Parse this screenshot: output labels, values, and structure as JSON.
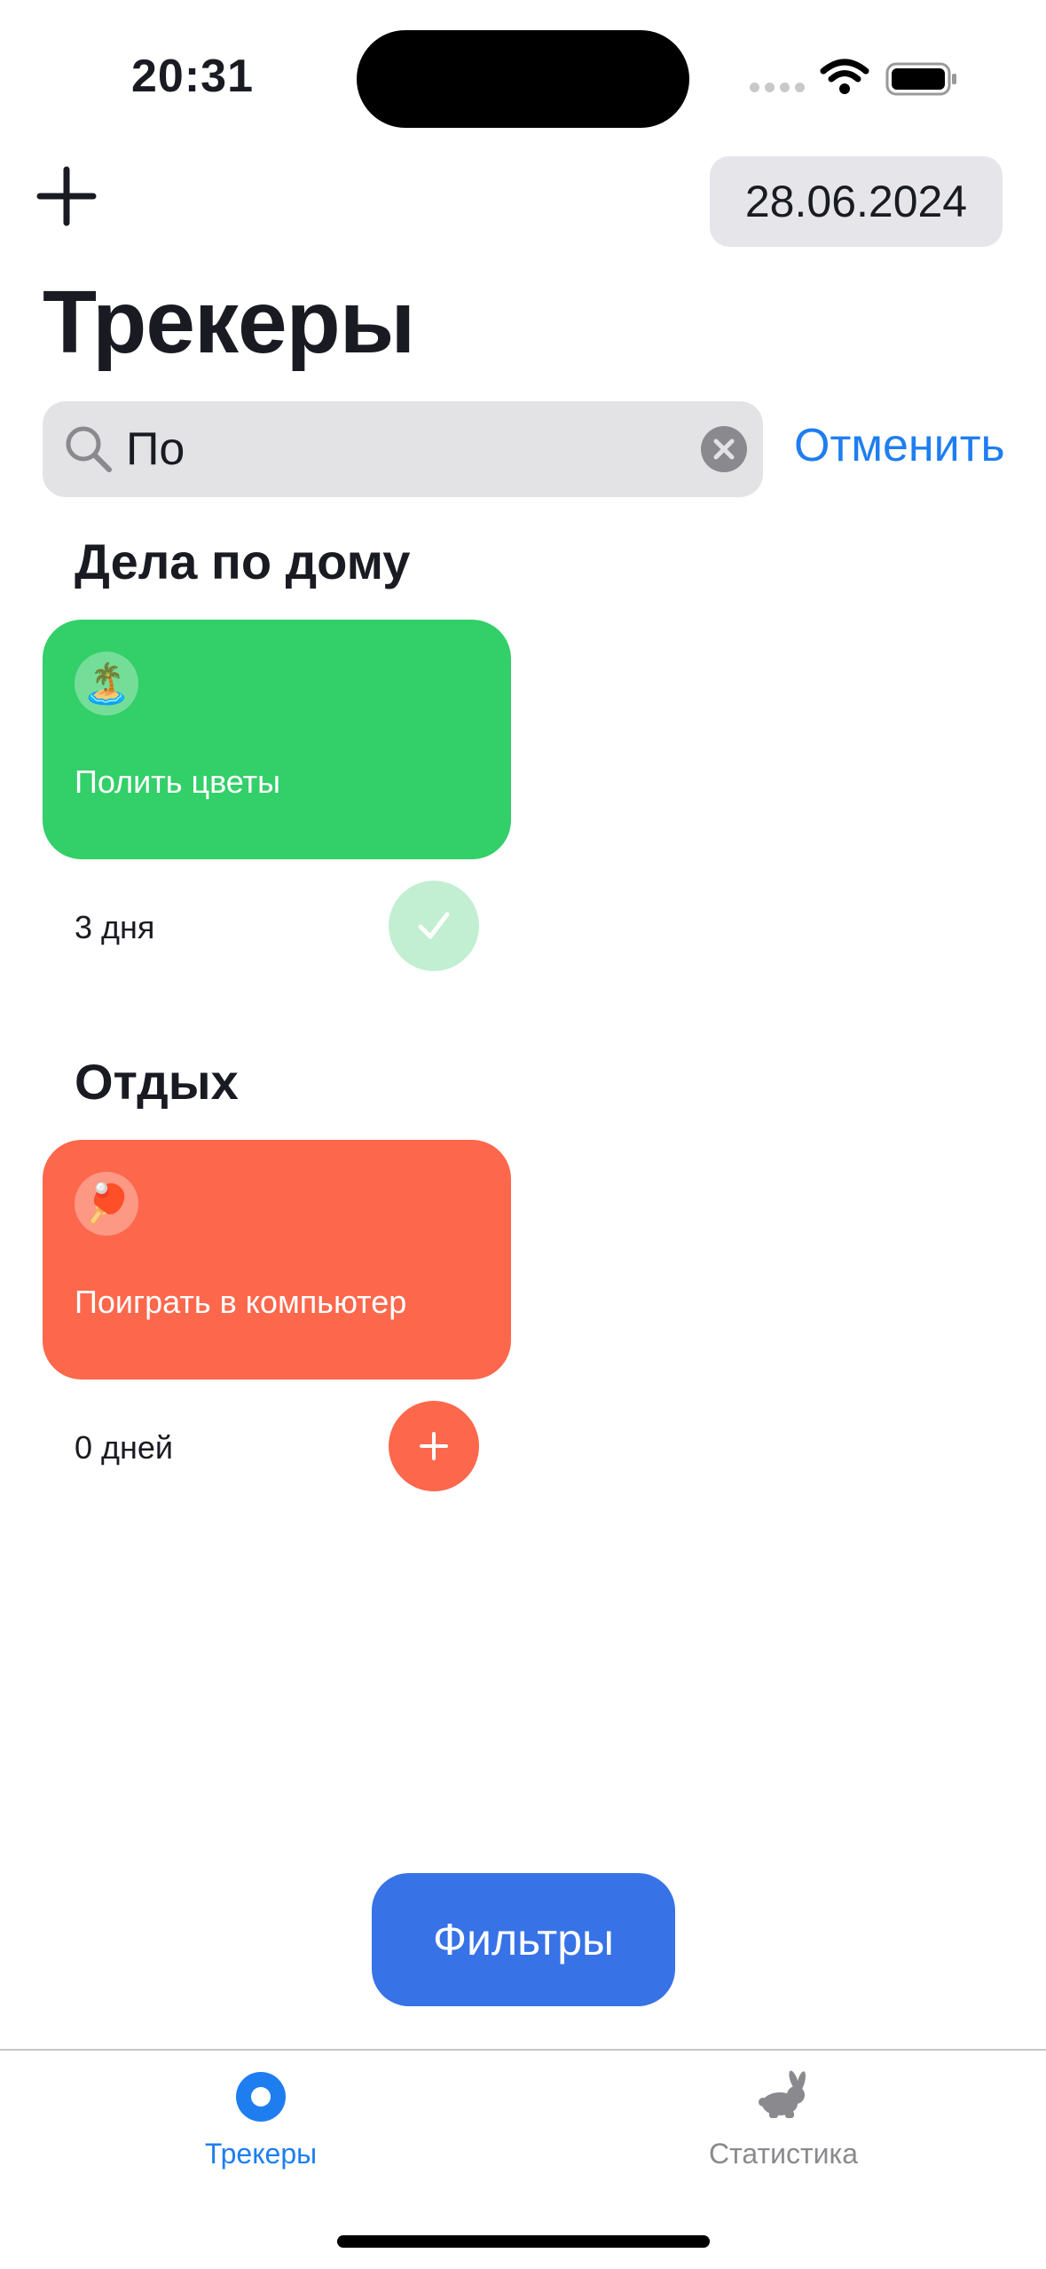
{
  "status": {
    "time": "20:31"
  },
  "header": {
    "date": "28.06.2024",
    "title": "Трекеры"
  },
  "search": {
    "value": "По",
    "cancel_label": "Отменить"
  },
  "sections": [
    {
      "title": "Дела по дому",
      "tracker": {
        "emoji": "🏝️",
        "label": "Полить цветы",
        "days": "3 дня",
        "color": "#33cf69",
        "done": true
      }
    },
    {
      "title": "Отдых",
      "tracker": {
        "emoji": "🏓",
        "label": "Поиграть в компьютер",
        "days": "0 дней",
        "color": "#fd674c",
        "done": false
      }
    }
  ],
  "filters_label": "Фильтры",
  "tabs": [
    {
      "label": "Трекеры",
      "icon": "trackers-icon",
      "active": true,
      "color": "#1e7ef0"
    },
    {
      "label": "Статистика",
      "icon": "rabbit-icon",
      "active": false,
      "color": "#8a8a8e"
    }
  ]
}
